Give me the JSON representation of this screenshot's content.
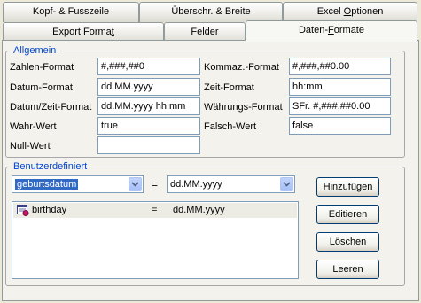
{
  "tabs": {
    "row_back": [
      {
        "label": "Kopf- & Fusszeile"
      },
      {
        "label": "Überschr. & Breite"
      },
      {
        "label_pre": "Excel ",
        "label_ul": "O",
        "label_post": "ptionen"
      }
    ],
    "row_front": [
      {
        "label_pre": "Export Forma",
        "label_ul": "t",
        "label_post": ""
      },
      {
        "label": "Felder"
      },
      {
        "label_pre": "Daten-",
        "label_ul": "F",
        "label_post": "ormate"
      }
    ]
  },
  "allgemein": {
    "legend": "Allgemein",
    "zahlen_format": {
      "label": "Zahlen-Format",
      "value": "#,###,##0"
    },
    "datum_format": {
      "label": "Datum-Format",
      "value": "dd.MM.yyyy"
    },
    "datum_zeit_format": {
      "label": "Datum/Zeit-Format",
      "value": "dd.MM.yyyy hh:mm"
    },
    "wahr_wert": {
      "label": "Wahr-Wert",
      "value": "true"
    },
    "null_wert": {
      "label": "Null-Wert",
      "value": ""
    },
    "kommaz_format": {
      "label": "Kommaz.-Format",
      "value": "#,###,##0.00"
    },
    "zeit_format": {
      "label": "Zeit-Format",
      "value": "hh:mm"
    },
    "waehrungs_format": {
      "label": "Währungs-Format",
      "value": "SFr. #,###,##0.00"
    },
    "falsch_wert": {
      "label": "Falsch-Wert",
      "value": "false"
    }
  },
  "benutzerdefiniert": {
    "legend": "Benutzerdefiniert",
    "field_select": "geburtsdatum",
    "equals": "=",
    "format_select": "dd.MM.yyyy",
    "list": [
      {
        "icon": "field-format-icon",
        "field": "birthday",
        "equals": "=",
        "format": "dd.MM.yyyy"
      }
    ],
    "buttons": {
      "add": "Hinzufügen",
      "edit": "Editieren",
      "delete": "Löschen",
      "clear": "Leeren"
    }
  },
  "colors": {
    "legend_text": "#0046d5",
    "selection": "#316ac5",
    "window_bg": "#ece9d8"
  }
}
